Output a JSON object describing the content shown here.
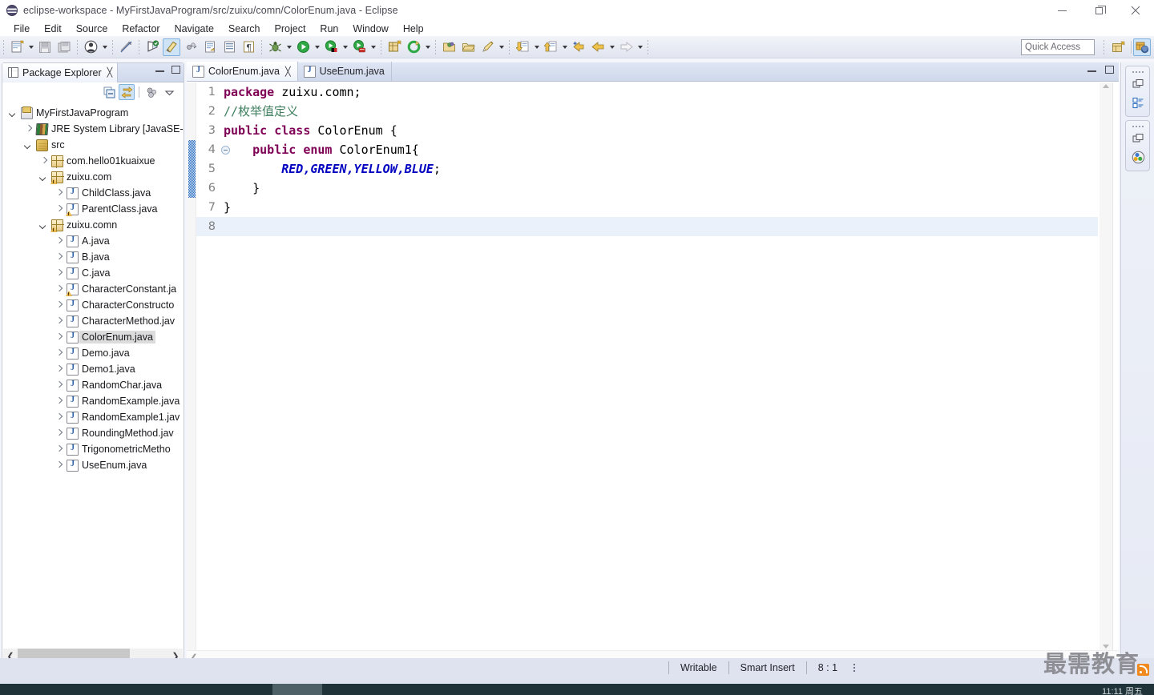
{
  "window": {
    "title": "eclipse-workspace - MyFirstJavaProgram/src/zuixu/comn/ColorEnum.java - Eclipse",
    "app_icon": "eclipse-icon",
    "controls": {
      "minimize": "minimize-icon",
      "maximize": "maximize-icon",
      "close": "close-icon"
    }
  },
  "menubar": {
    "items": [
      {
        "label": "File"
      },
      {
        "label": "Edit"
      },
      {
        "label": "Source"
      },
      {
        "label": "Refactor"
      },
      {
        "label": "Navigate"
      },
      {
        "label": "Search"
      },
      {
        "label": "Project"
      },
      {
        "label": "Run"
      },
      {
        "label": "Window"
      },
      {
        "label": "Help"
      }
    ]
  },
  "toolbar": {
    "quick_access_placeholder": "Quick Access",
    "buttons": [
      {
        "name": "new-wizard-icon",
        "glyph": "new"
      },
      {
        "name": "new-dropdown-arrow",
        "glyph": "arrow"
      },
      {
        "name": "save-icon",
        "glyph": "save"
      },
      {
        "name": "save-all-icon",
        "glyph": "saveall"
      },
      {
        "name": "person-icon",
        "glyph": "person"
      },
      {
        "name": "person-dropdown-arrow",
        "glyph": "arrow"
      },
      {
        "name": "toggle-mark-occurrences-icon",
        "glyph": "occur"
      },
      {
        "name": "new-java-project-icon",
        "glyph": "javaproj"
      },
      {
        "name": "new-java-class-icon",
        "glyph": "javaclass"
      },
      {
        "name": "open-type-icon",
        "glyph": "opentype"
      },
      {
        "name": "open-task-icon",
        "glyph": "task"
      },
      {
        "name": "show-whitespace-icon",
        "glyph": "para"
      },
      {
        "name": "pilcrow-icon",
        "glyph": "pilcrow"
      },
      {
        "name": "debug-icon",
        "glyph": "bug"
      },
      {
        "name": "debug-dropdown-arrow",
        "glyph": "arrow"
      },
      {
        "name": "run-icon",
        "glyph": "run"
      },
      {
        "name": "run-dropdown-arrow",
        "glyph": "arrow"
      },
      {
        "name": "coverage-icon",
        "glyph": "cov"
      },
      {
        "name": "coverage-dropdown-arrow",
        "glyph": "arrow"
      },
      {
        "name": "external-tools-icon",
        "glyph": "ext"
      },
      {
        "name": "external-tools-dropdown-arrow",
        "glyph": "arrow"
      },
      {
        "name": "new-package-icon",
        "glyph": "pkg"
      },
      {
        "name": "refresh-icon",
        "glyph": "refresh"
      },
      {
        "name": "refresh-dropdown-arrow",
        "glyph": "arrow"
      },
      {
        "name": "open-folder-icon",
        "glyph": "openfolder"
      },
      {
        "name": "open-folder2-icon",
        "glyph": "folder2"
      },
      {
        "name": "pencil-icon",
        "glyph": "pencil"
      },
      {
        "name": "pencil-dropdown-arrow",
        "glyph": "arrow"
      },
      {
        "name": "next-annotation-icon",
        "glyph": "down"
      },
      {
        "name": "next-annotation-dropdown-arrow",
        "glyph": "arrow"
      },
      {
        "name": "previous-annotation-icon",
        "glyph": "up"
      },
      {
        "name": "previous-annotation-dropdown-arrow",
        "glyph": "arrow"
      },
      {
        "name": "last-edit-location-icon",
        "glyph": "lastedit"
      },
      {
        "name": "back-icon",
        "glyph": "back"
      },
      {
        "name": "back-dropdown-arrow",
        "glyph": "arrow"
      },
      {
        "name": "forward-icon",
        "glyph": "fwd"
      },
      {
        "name": "forward-dropdown-arrow",
        "glyph": "arrow"
      }
    ],
    "perspective_open": "open-perspective-icon",
    "perspective_java": "java-perspective-icon"
  },
  "sidebar": {
    "view_title": "Package Explorer",
    "view_icon": "package-explorer-icon",
    "close_icon": "view-close-icon",
    "minimize_icon": "view-minimize-icon",
    "maximize_icon": "view-maximize-icon",
    "tools": [
      {
        "name": "collapse-all-icon",
        "active": false
      },
      {
        "name": "link-with-editor-icon",
        "active": true
      },
      {
        "name": "view-menu-filter-icon",
        "active": false
      },
      {
        "name": "view-menu-icon",
        "active": false
      }
    ],
    "tree": [
      {
        "label": "MyFirstJavaProgram",
        "indent": 0,
        "twisty": "open",
        "icon": "java-project-icon",
        "warn": false,
        "selected": false
      },
      {
        "label": "JRE System Library [JavaSE-",
        "indent": 1,
        "twisty": "closed",
        "icon": "jre-library-icon",
        "warn": false,
        "selected": false
      },
      {
        "label": "src",
        "indent": 1,
        "twisty": "open",
        "icon": "source-folder-icon",
        "warn": false,
        "selected": false
      },
      {
        "label": "com.hello01kuaixue",
        "indent": 2,
        "twisty": "closed",
        "icon": "package-icon",
        "warn": false,
        "selected": false
      },
      {
        "label": "zuixu.com",
        "indent": 2,
        "twisty": "open",
        "icon": "package-icon",
        "warn": true,
        "selected": false
      },
      {
        "label": "ChildClass.java",
        "indent": 3,
        "twisty": "closed",
        "icon": "java-file-icon",
        "warn": false,
        "selected": false
      },
      {
        "label": "ParentClass.java",
        "indent": 3,
        "twisty": "closed",
        "icon": "java-file-icon",
        "warn": true,
        "selected": false
      },
      {
        "label": "zuixu.comn",
        "indent": 2,
        "twisty": "open",
        "icon": "package-icon",
        "warn": true,
        "selected": false
      },
      {
        "label": "A.java",
        "indent": 3,
        "twisty": "closed",
        "icon": "java-file-icon",
        "warn": false,
        "selected": false
      },
      {
        "label": "B.java",
        "indent": 3,
        "twisty": "closed",
        "icon": "java-file-icon",
        "warn": false,
        "selected": false
      },
      {
        "label": "C.java",
        "indent": 3,
        "twisty": "closed",
        "icon": "java-file-icon",
        "warn": false,
        "selected": false
      },
      {
        "label": "CharacterConstant.ja",
        "indent": 3,
        "twisty": "closed",
        "icon": "java-file-icon",
        "warn": true,
        "selected": false
      },
      {
        "label": "CharacterConstructo",
        "indent": 3,
        "twisty": "closed",
        "icon": "java-file-icon",
        "warn": false,
        "selected": false
      },
      {
        "label": "CharacterMethod.jav",
        "indent": 3,
        "twisty": "closed",
        "icon": "java-file-icon",
        "warn": false,
        "selected": false
      },
      {
        "label": "ColorEnum.java",
        "indent": 3,
        "twisty": "closed",
        "icon": "java-file-icon",
        "warn": false,
        "selected": true
      },
      {
        "label": "Demo.java",
        "indent": 3,
        "twisty": "closed",
        "icon": "java-file-icon",
        "warn": false,
        "selected": false
      },
      {
        "label": "Demo1.java",
        "indent": 3,
        "twisty": "closed",
        "icon": "java-file-icon",
        "warn": false,
        "selected": false
      },
      {
        "label": "RandomChar.java",
        "indent": 3,
        "twisty": "closed",
        "icon": "java-file-icon",
        "warn": false,
        "selected": false
      },
      {
        "label": "RandomExample.java",
        "indent": 3,
        "twisty": "closed",
        "icon": "java-file-icon",
        "warn": false,
        "selected": false
      },
      {
        "label": "RandomExample1.jav",
        "indent": 3,
        "twisty": "closed",
        "icon": "java-file-icon",
        "warn": false,
        "selected": false
      },
      {
        "label": "RoundingMethod.jav",
        "indent": 3,
        "twisty": "closed",
        "icon": "java-file-icon",
        "warn": false,
        "selected": false
      },
      {
        "label": "TrigonometricMetho",
        "indent": 3,
        "twisty": "closed",
        "icon": "java-file-icon",
        "warn": false,
        "selected": false
      },
      {
        "label": "UseEnum.java",
        "indent": 3,
        "twisty": "closed",
        "icon": "java-file-icon",
        "warn": false,
        "selected": false
      }
    ]
  },
  "editor": {
    "tabs": [
      {
        "label": "ColorEnum.java",
        "active": true,
        "icon": "java-file-icon",
        "close_icon": "tab-close-icon"
      },
      {
        "label": "UseEnum.java",
        "active": false,
        "icon": "java-file-icon"
      }
    ],
    "minimize_icon": "editor-minimize-icon",
    "maximize_icon": "editor-maximize-icon",
    "lines": [
      {
        "no": "1",
        "fold": false,
        "current": false,
        "tokens": [
          {
            "t": "package",
            "c": "kw"
          },
          {
            "t": " zuixu.comn;",
            "c": "pl"
          }
        ]
      },
      {
        "no": "2",
        "fold": false,
        "current": false,
        "tokens": [
          {
            "t": "//枚举值定义",
            "c": "cm"
          }
        ]
      },
      {
        "no": "3",
        "fold": false,
        "current": false,
        "tokens": [
          {
            "t": "public class",
            "c": "kw"
          },
          {
            "t": " ColorEnum {",
            "c": "pl"
          }
        ]
      },
      {
        "no": "4",
        "fold": true,
        "current": false,
        "tokens": [
          {
            "t": "    ",
            "c": "pl"
          },
          {
            "t": "public enum",
            "c": "kw"
          },
          {
            "t": " ColorEnum1{",
            "c": "pl"
          }
        ]
      },
      {
        "no": "5",
        "fold": false,
        "current": false,
        "tokens": [
          {
            "t": "        ",
            "c": "pl"
          },
          {
            "t": "RED,GREEN,YELLOW,BLUE",
            "c": "st"
          },
          {
            "t": ";",
            "c": "pl"
          }
        ]
      },
      {
        "no": "6",
        "fold": false,
        "current": false,
        "tokens": [
          {
            "t": "    }",
            "c": "pl"
          }
        ]
      },
      {
        "no": "7",
        "fold": false,
        "current": false,
        "tokens": [
          {
            "t": "}",
            "c": "pl"
          }
        ]
      },
      {
        "no": "8",
        "fold": false,
        "current": true,
        "tokens": [
          {
            "t": "",
            "c": "pl"
          }
        ]
      }
    ]
  },
  "rightbar": {
    "groups": [
      {
        "icons": [
          "restore-icon",
          "outline-view-icon"
        ]
      },
      {
        "icons": [
          "restore-icon",
          "palette-view-icon"
        ]
      }
    ]
  },
  "statusbar": {
    "writable": "Writable",
    "insert_mode": "Smart Insert",
    "position": "8 : 1",
    "overflow_icon": "status-overflow-icon"
  },
  "watermark": {
    "text": "最需教育",
    "badge_icon": "rss-icon"
  },
  "taskbar": {
    "time": "11:11 周五"
  }
}
